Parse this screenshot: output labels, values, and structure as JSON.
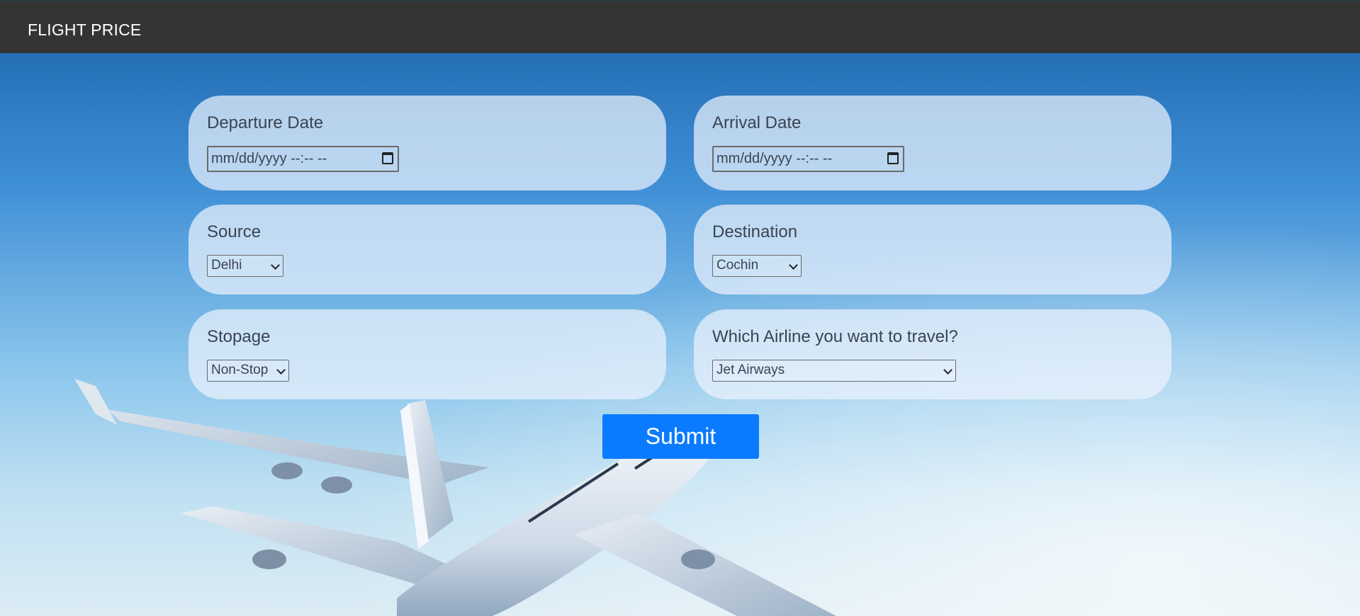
{
  "navbar": {
    "brand": "FLIGHT PRICE"
  },
  "form": {
    "departure": {
      "label": "Departure Date",
      "placeholder": "mm/dd/yyyy --:-- --"
    },
    "arrival": {
      "label": "Arrival Date",
      "placeholder": "mm/dd/yyyy --:-- --"
    },
    "source": {
      "label": "Source",
      "selected": "Delhi"
    },
    "destination": {
      "label": "Destination",
      "selected": "Cochin"
    },
    "stopage": {
      "label": "Stopage",
      "selected": "Non-Stop"
    },
    "airline": {
      "label": "Which Airline you want to travel?",
      "selected": "Jet Airways"
    },
    "submit_label": "Submit"
  },
  "colors": {
    "navbar": "#343434",
    "submit": "#0a7bff",
    "label": "#3a4452",
    "card": "#ebf3fc"
  },
  "icons": [
    "calendar-icon",
    "chevron-down-icon"
  ]
}
